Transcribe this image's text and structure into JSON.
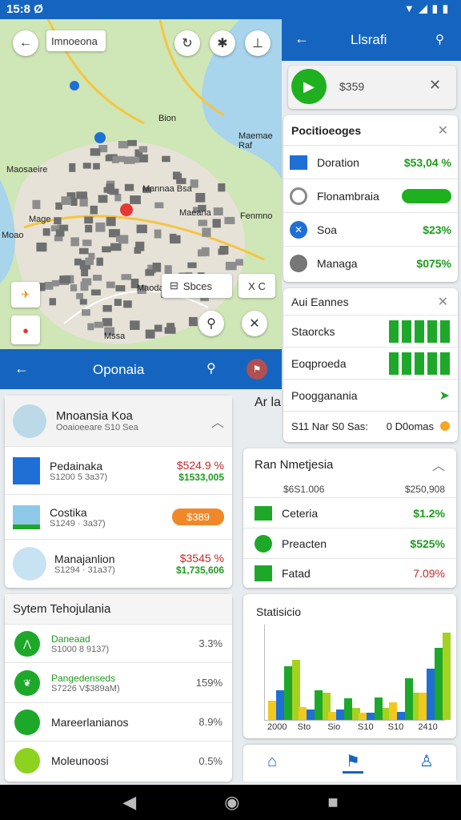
{
  "status": {
    "time": "15:8 Ø",
    "icons": "▼◢▮▮"
  },
  "map": {
    "search_label": "Imnoeona",
    "labels": {
      "a": "Bion",
      "b": "Maemae Raf",
      "c": "Maosaeire",
      "d": "Mage",
      "e": "Mannaa Bsa",
      "f": "Maeana",
      "g": "Fenmno",
      "h": "Moao",
      "i": "Maoda",
      "j": "Mssa"
    },
    "search_chip": "Sbces",
    "close_chip": "X C"
  },
  "right_top": {
    "title": "Llsrafi",
    "amount": "$359",
    "section_title": "Pocitioeoges",
    "items": [
      {
        "label": "Doration",
        "value": "$53,04 %"
      },
      {
        "label": "Flonambraia",
        "value": ""
      },
      {
        "label": "Soa",
        "value": "$23%"
      },
      {
        "label": "Managa",
        "value": "$075%"
      }
    ]
  },
  "right_mid": {
    "title": "Aui Eannes",
    "items": [
      {
        "label": "Staorcks"
      },
      {
        "label": "Eoqproeda"
      },
      {
        "label": "Poogganania"
      }
    ],
    "footer_left": "S11 Nar S0 Sas:",
    "footer_right": "0 D0omas",
    "partial": "Ar la"
  },
  "opon": {
    "title": "Oponaia",
    "header_title": "Mnoansia Koa",
    "header_sub": "Ooaioeeare S10 Sea",
    "items": [
      {
        "label": "Pedainaka",
        "sub": "S1200 5 3a37)",
        "val1": "$524.9 %",
        "val2": "$1533,005"
      },
      {
        "label": "Costika",
        "sub": "S1249 · 3a37)",
        "badge": "$389"
      },
      {
        "label": "Manajanlion",
        "sub": "S1294 · 31a37)",
        "val1": "$3545 %",
        "val2": "$1,735,606"
      }
    ]
  },
  "system": {
    "title": "Sytem Tehojulania",
    "items": [
      {
        "label": "Daneaad",
        "sub": "S1000 8 9137)",
        "value": "3.3%"
      },
      {
        "label": "Pangedenseds",
        "sub": "S7226 V$389aM)",
        "value": "159%"
      },
      {
        "label": "Mareerlanianos",
        "sub": "",
        "value": "8.9%"
      },
      {
        "label": "Moleunoosi",
        "sub": "",
        "value": "0.5%"
      }
    ]
  },
  "ran": {
    "title": "Ran Nmetjesia",
    "sub_left": "$6S1.006",
    "sub_right": "$250,908",
    "items": [
      {
        "label": "Ceteria",
        "value": "$1.2%"
      },
      {
        "label": "Preacten",
        "value": "$525%"
      },
      {
        "label": "Fatad",
        "value": "7.09%"
      }
    ]
  },
  "chart_data": {
    "type": "bar",
    "title": "Statisicio",
    "categories": [
      "2000",
      "Sto",
      "Sio",
      "S10",
      "S10",
      "2410"
    ],
    "series": [
      {
        "values": [
          32,
          22,
          13,
          12,
          30,
          45
        ]
      },
      {
        "values": [
          50,
          18,
          18,
          12,
          14,
          85
        ]
      },
      {
        "values": [
          90,
          50,
          36,
          37,
          70,
          120
        ]
      },
      {
        "values": [
          100,
          45,
          20,
          20,
          46,
          145
        ]
      }
    ],
    "colors": [
      "#f2c81e",
      "#1e6fd6",
      "#1ea82a",
      "#a5d21e"
    ],
    "ylim": [
      0,
      160
    ]
  },
  "bottom_nav": [
    "home-icon",
    "map-icon",
    "person-icon"
  ]
}
